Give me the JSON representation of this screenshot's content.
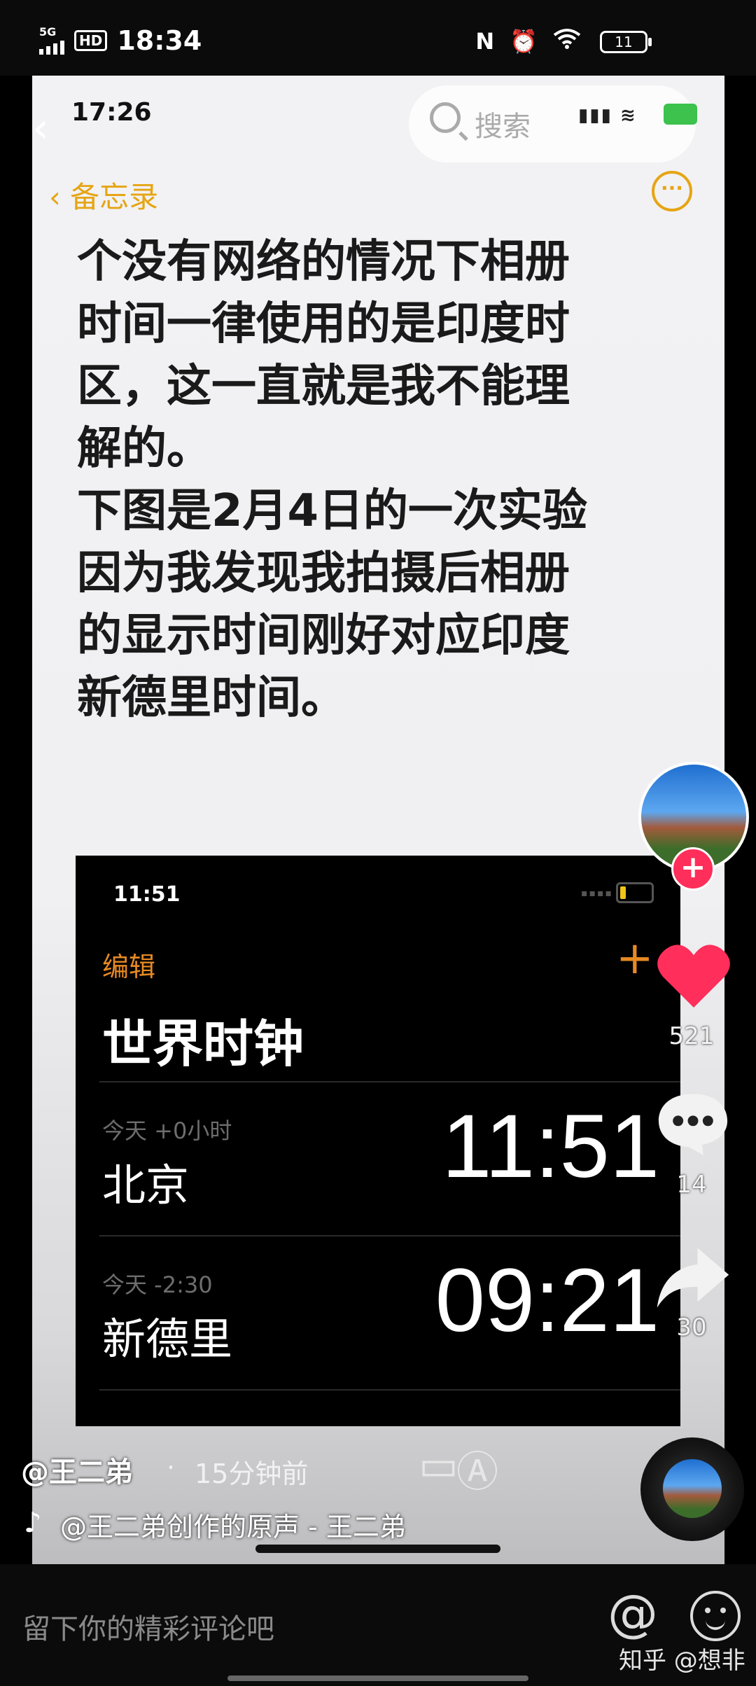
{
  "status_bar": {
    "network": "5G",
    "hd": "HD",
    "time": "18:34",
    "nfc_icon": "N",
    "battery": "11"
  },
  "video": {
    "time": "17:26",
    "search_placeholder": "搜索",
    "notes_back": "备忘录",
    "note_text": "个没有网络的情况下相册\n时间一律使用的是印度时\n区，这一直就是我不能理\n解的。\n下图是2月4日的一次实验\n因为我发现我拍摄后相册\n的显示时间刚好对应印度\n新德里时间。",
    "clock": {
      "time": "11:51",
      "edit": "编辑",
      "add": "+",
      "title": "世界时钟",
      "rows": [
        {
          "offset": "今天 +0小时",
          "city": "北京",
          "time": "11:51"
        },
        {
          "offset": "今天 -2:30",
          "city": "新德里",
          "time": "09:21"
        }
      ]
    }
  },
  "actions": {
    "likes": "521",
    "comments": "14",
    "shares": "30"
  },
  "post": {
    "author": "@王二弟",
    "separator": "·",
    "time_ago": "15分钟前",
    "music": "@王二弟创作的原声 - 王二弟"
  },
  "comment_bar": {
    "placeholder": "留下你的精彩评论吧",
    "at": "@"
  },
  "watermark": "知乎 @想非",
  "colors": {
    "notes_accent": "#e6a514",
    "clock_accent": "#e68a23",
    "like": "#ff2e5a"
  }
}
